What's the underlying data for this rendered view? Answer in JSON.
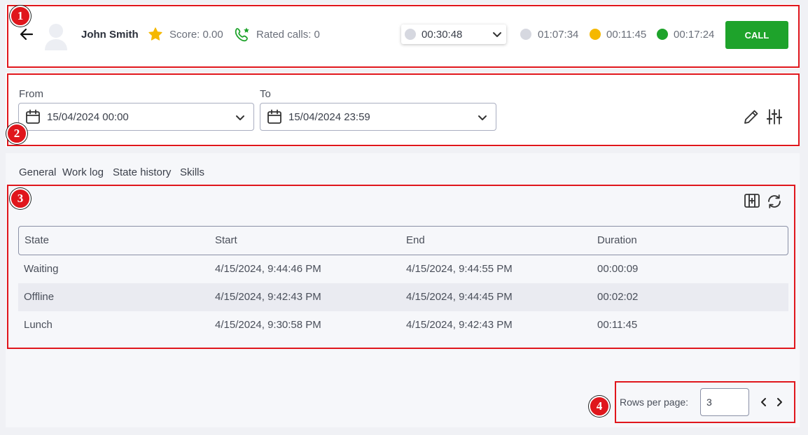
{
  "header": {
    "agent_name": "John Smith",
    "score_label": "Score: 0.00",
    "rated_calls_label": "Rated calls: 0",
    "timer_selected": "00:30:48",
    "timers": [
      {
        "value": "01:07:34",
        "color": "#d6d8e0"
      },
      {
        "value": "00:11:45",
        "color": "#f5b800"
      },
      {
        "value": "00:17:24",
        "color": "#1ea32b"
      }
    ],
    "call_label": "CALL",
    "star_color": "#f5b800",
    "phone_color": "#1ea32b"
  },
  "filters": {
    "from_label": "From",
    "from_value": "15/04/2024 00:00",
    "to_label": "To",
    "to_value": "15/04/2024 23:59"
  },
  "tabs": [
    {
      "label": "General"
    },
    {
      "label": "Work log"
    },
    {
      "label": "State history",
      "active": true
    },
    {
      "label": "Skills"
    }
  ],
  "table": {
    "headers": [
      "State",
      "Start",
      "End",
      "Duration"
    ],
    "rows": [
      [
        "Waiting",
        "4/15/2024, 9:44:46 PM",
        "4/15/2024, 9:44:55 PM",
        "00:00:09"
      ],
      [
        "Offline",
        "4/15/2024, 9:42:43 PM",
        "4/15/2024, 9:44:45 PM",
        "00:02:02"
      ],
      [
        "Lunch",
        "4/15/2024, 9:30:58 PM",
        "4/15/2024, 9:42:43 PM",
        "00:11:45"
      ]
    ]
  },
  "pagination": {
    "rows_label": "Rows per page:",
    "rows_value": "3"
  },
  "annotations": [
    "1",
    "2",
    "3",
    "4"
  ]
}
